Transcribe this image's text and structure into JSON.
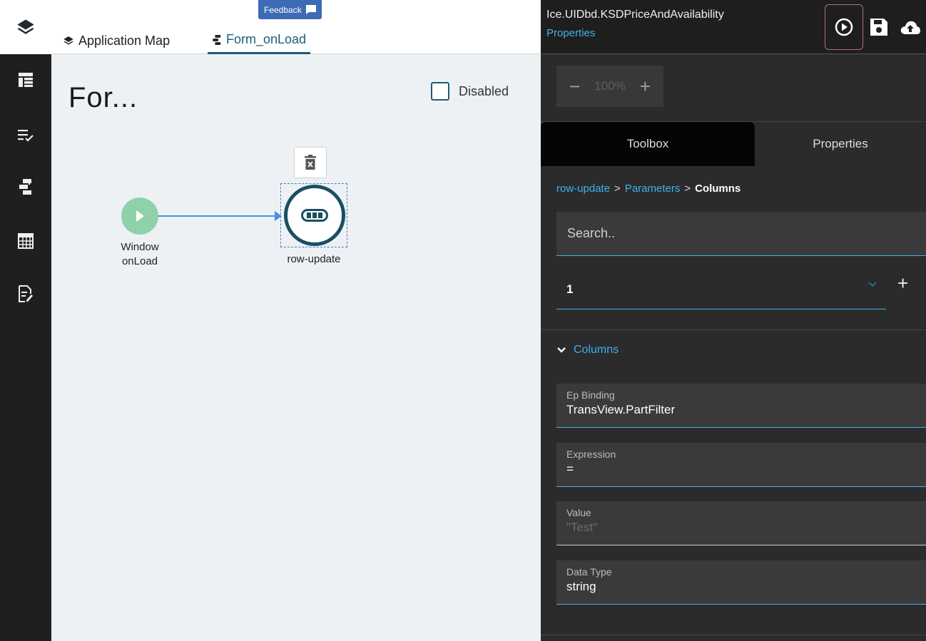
{
  "rail": {
    "items": [
      {
        "name": "layout-icon"
      },
      {
        "name": "checklist-icon"
      },
      {
        "name": "workflow-icon"
      },
      {
        "name": "grid-icon"
      },
      {
        "name": "edit-document-icon"
      }
    ]
  },
  "topbar": {
    "feedback_label": "Feedback",
    "tabs": [
      {
        "label": "Application Map",
        "active": false
      },
      {
        "label": "Form_onLoad",
        "active": true
      }
    ]
  },
  "canvas": {
    "title": "For...",
    "disabled_label": "Disabled",
    "disabled_checked": false,
    "start_node": {
      "line1": "Window",
      "line2": "onLoad"
    },
    "action_node": {
      "label": "row-update"
    }
  },
  "panel": {
    "app_name": "Ice.UIDbd.KSDPriceAndAvailability",
    "properties_link": "Properties",
    "zoom": {
      "minus": "−",
      "value": "100%",
      "plus": "+"
    },
    "tabs": [
      {
        "label": "Toolbox",
        "active": true
      },
      {
        "label": "Properties",
        "active": false
      }
    ],
    "breadcrumb": {
      "first": "row-update",
      "sep": ">",
      "second": "Parameters",
      "current": "Columns"
    },
    "search_placeholder": "Search..",
    "select": {
      "value": "1",
      "add": "+"
    },
    "section_label": "Columns",
    "fields": [
      {
        "label": "Ep Binding",
        "value": "TransView.PartFilter"
      },
      {
        "label": "Expression",
        "value": "="
      },
      {
        "label": "Value",
        "value": "\"Test\""
      },
      {
        "label": "Data Type",
        "value": "string"
      }
    ]
  },
  "colors": {
    "accent": "#3db4e8",
    "node_border": "#1a4f60",
    "start_node": "#8fd1a8",
    "connector": "#4a90e2",
    "feedback": "#3d6bb5"
  }
}
